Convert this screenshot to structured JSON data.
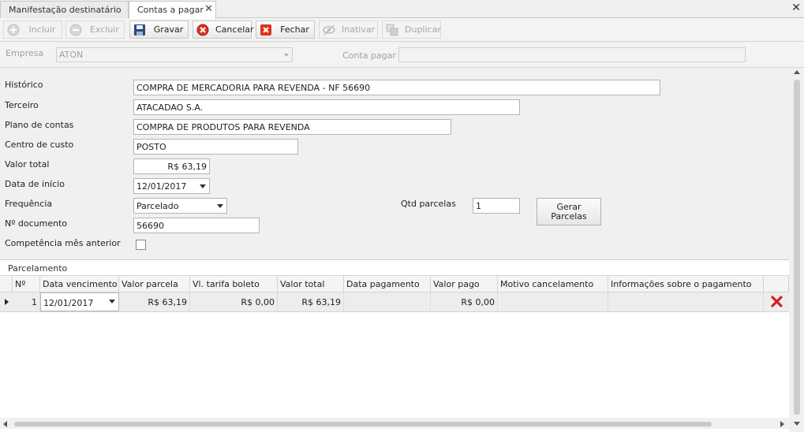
{
  "tabs": [
    {
      "label": "Manifestação destinatário",
      "active": false
    },
    {
      "label": "Contas a pagar",
      "active": true
    }
  ],
  "toolbar": {
    "incluir": "Incluir",
    "excluir": "Excluir",
    "gravar": "Gravar",
    "cancelar": "Cancelar",
    "fechar": "Fechar",
    "inativar": "Inativar",
    "duplicar": "Duplicar"
  },
  "header": {
    "empresa_label": "Empresa",
    "empresa_value": "ATON",
    "conta_pagar_label": "Conta pagar",
    "conta_pagar_value": ""
  },
  "form": {
    "historico_label": "Histórico",
    "historico_value": "COMPRA DE MERCADORIA PARA REVENDA - NF 56690",
    "terceiro_label": "Terceiro",
    "terceiro_value": "ATACADAO S.A.",
    "plano_label": "Plano de contas",
    "plano_value": "COMPRA DE PRODUTOS PARA REVENDA",
    "centro_label": "Centro de custo",
    "centro_value": "POSTO",
    "valor_label": "Valor total",
    "valor_value": "R$ 63,19",
    "data_label": "Data de início",
    "data_value": "12/01/2017",
    "freq_label": "Frequência",
    "freq_value": "Parcelado",
    "doc_label": "Nº documento",
    "doc_value": "56690",
    "comp_label": "Competência mês anterior",
    "comp_checked": false,
    "qtd_label": "Qtd parcelas",
    "qtd_value": "1",
    "gerar_line1": "Gerar",
    "gerar_line2": "Parcelas"
  },
  "parcelamento": {
    "title": "Parcelamento",
    "columns": [
      "Nº",
      "Data vencimento",
      "Valor parcela",
      "Vl. tarifa boleto",
      "Valor total",
      "Data pagamento",
      "Valor pago",
      "Motivo cancelamento",
      "Informações sobre o pagamento"
    ],
    "rows": [
      {
        "num": "1",
        "data_vencimento": "12/01/2017",
        "valor_parcela": "R$ 63,19",
        "tarifa": "R$ 0,00",
        "valor_total": "R$ 63,19",
        "data_pagamento": "",
        "valor_pago": "R$ 0,00",
        "motivo": "",
        "info": ""
      }
    ]
  },
  "colors": {
    "delete_red": "#d42020",
    "cancel_red": "#d9331f"
  }
}
